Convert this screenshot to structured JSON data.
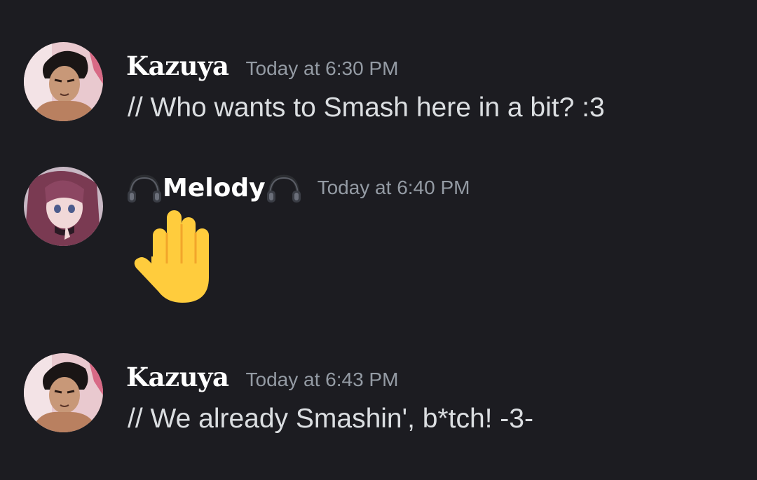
{
  "messages": [
    {
      "author": "Kazuya",
      "timestamp": "Today at 6:30 PM",
      "text": "// Who wants to Smash here in a bit? :3",
      "avatar_icon": "kazuya-avatar"
    },
    {
      "author": "Melody",
      "name_decoration": "headphones-emoji",
      "timestamp": "Today at 6:40 PM",
      "emoji": "raised-hand-emoji",
      "avatar_icon": "melody-avatar"
    },
    {
      "author": "Kazuya",
      "timestamp": "Today at 6:43 PM",
      "text": "// We already Smashin', b*tch! -3-",
      "avatar_icon": "kazuya-avatar"
    }
  ],
  "colors": {
    "background": "#1c1c21",
    "username": "#ffffff",
    "timestamp": "#949ba4",
    "message_text": "#dbdee1"
  }
}
